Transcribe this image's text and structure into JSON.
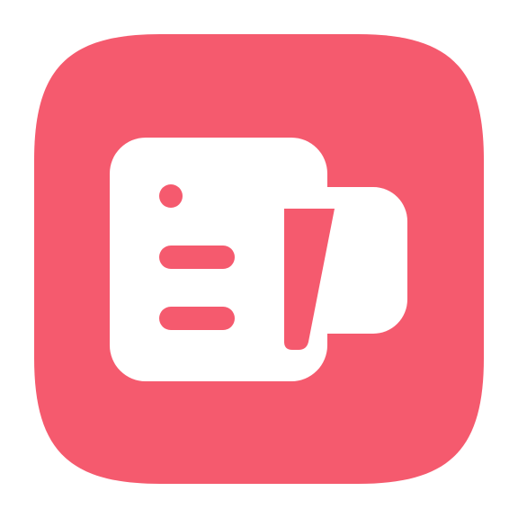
{
  "icon": {
    "name": "notes-app-icon",
    "glyph": "document-with-folded-flap-icon",
    "colors": {
      "background": "#f55a6e",
      "glyph": "#ffffff",
      "page_background": "#ffffff"
    }
  }
}
